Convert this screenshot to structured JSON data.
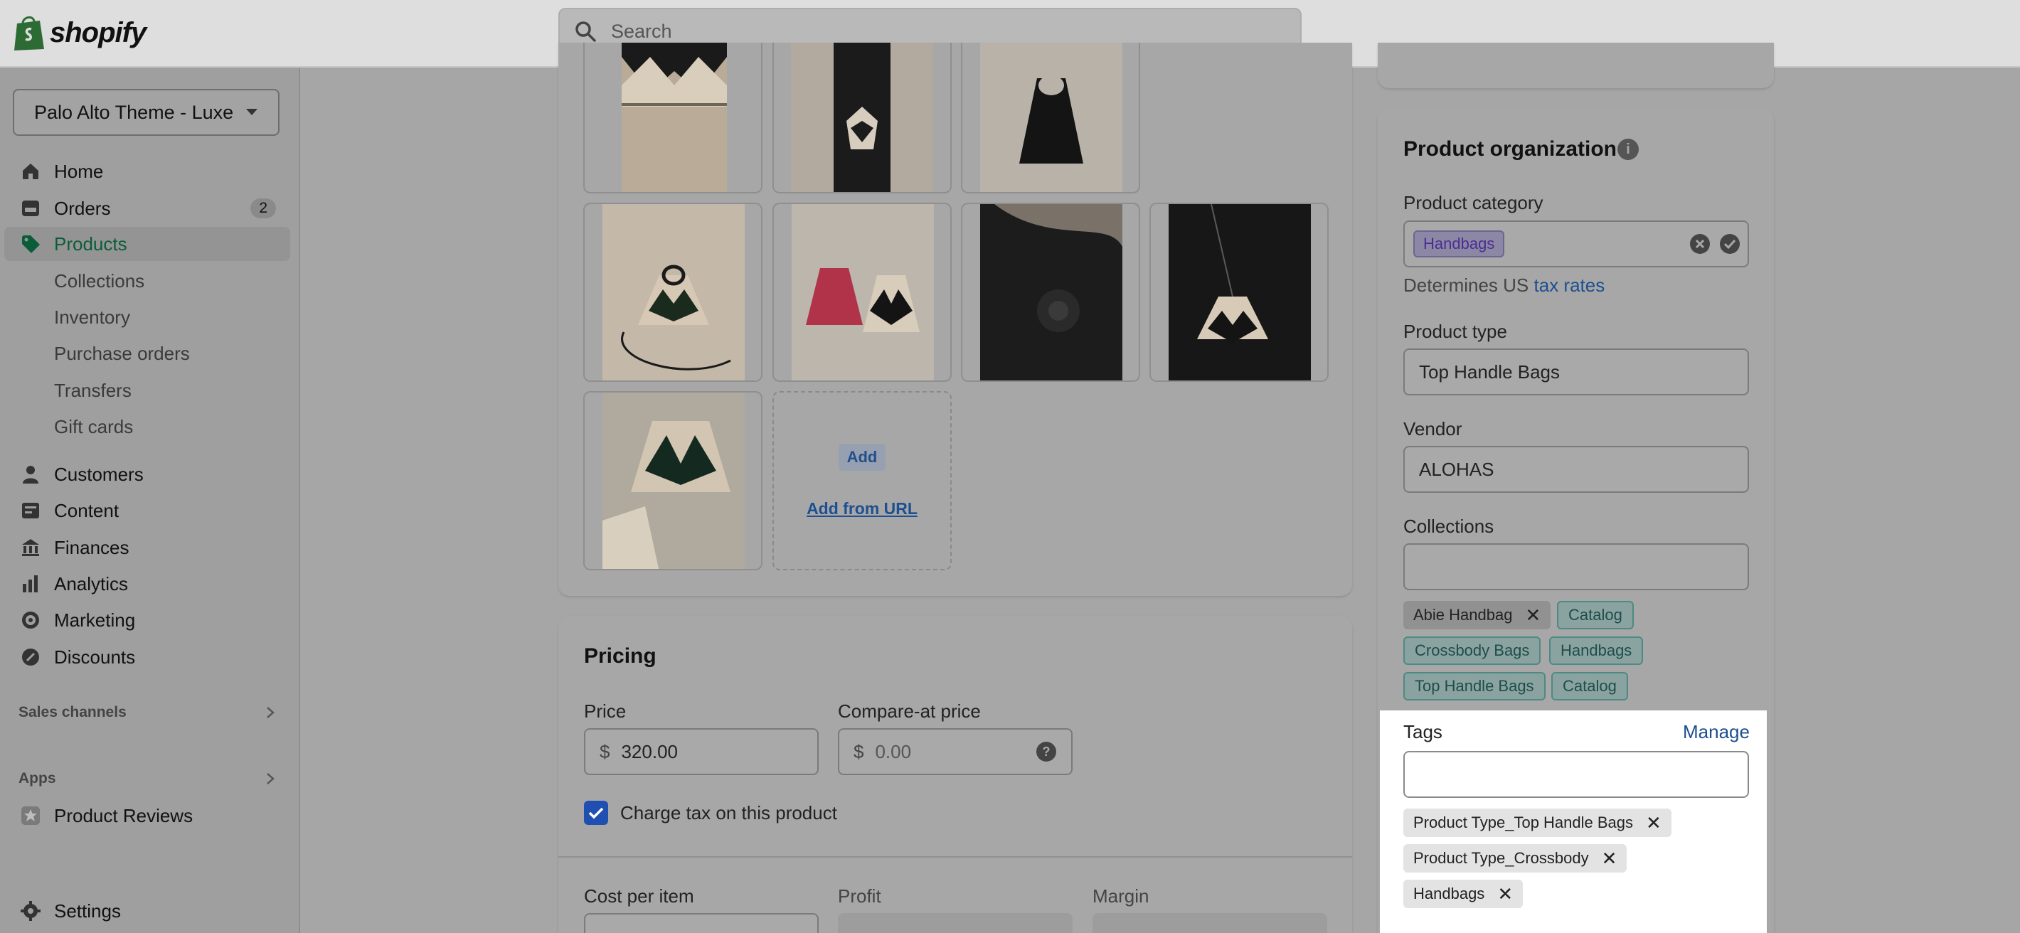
{
  "brand": {
    "name": "shopify"
  },
  "search": {
    "placeholder": "Search"
  },
  "store": {
    "name": "Palo Alto Theme - Luxe"
  },
  "nav": {
    "items": [
      {
        "label": "Home",
        "icon": "home-icon"
      },
      {
        "label": "Orders",
        "icon": "orders-icon",
        "badge": "2"
      },
      {
        "label": "Products",
        "icon": "tag-icon",
        "active": true
      },
      {
        "label": "Collections",
        "sub": true
      },
      {
        "label": "Inventory",
        "sub": true
      },
      {
        "label": "Purchase orders",
        "sub": true
      },
      {
        "label": "Transfers",
        "sub": true
      },
      {
        "label": "Gift cards",
        "sub": true
      },
      {
        "label": "Customers",
        "icon": "person-icon"
      },
      {
        "label": "Content",
        "icon": "content-icon"
      },
      {
        "label": "Finances",
        "icon": "bank-icon"
      },
      {
        "label": "Analytics",
        "icon": "chart-icon"
      },
      {
        "label": "Marketing",
        "icon": "target-icon"
      },
      {
        "label": "Discounts",
        "icon": "discount-icon"
      }
    ],
    "sales_channels": "Sales channels",
    "apps": "Apps",
    "app_item": "Product Reviews",
    "settings": "Settings"
  },
  "media": {
    "add_label": "Add",
    "add_from_url_label": "Add from URL"
  },
  "pricing": {
    "title": "Pricing",
    "price_label": "Price",
    "price_currency": "$",
    "price_value": "320.00",
    "compare_label": "Compare-at price",
    "compare_currency": "$",
    "compare_placeholder": "0.00",
    "charge_tax_label": "Charge tax on this product",
    "charge_tax_checked": true,
    "cost_label": "Cost per item",
    "profit_label": "Profit",
    "margin_label": "Margin"
  },
  "organization": {
    "title": "Product organization",
    "category_label": "Product category",
    "category_value": "Handbags",
    "category_help_prefix": "Determines US",
    "category_help_link": "tax rates",
    "type_label": "Product type",
    "type_value": "Top Handle Bags",
    "vendor_label": "Vendor",
    "vendor_value": "ALOHAS",
    "collections_label": "Collections",
    "collections": [
      {
        "label": "Abie Handbag",
        "style": "grey",
        "removable": true
      },
      {
        "label": "Catalog",
        "style": "teal"
      },
      {
        "label": "Crossbody Bags",
        "style": "teal"
      },
      {
        "label": "Handbags",
        "style": "teal"
      },
      {
        "label": "Top Handle Bags",
        "style": "teal"
      },
      {
        "label": "Catalog",
        "style": "teal"
      }
    ],
    "tags_label": "Tags",
    "manage_label": "Manage",
    "tags": [
      "Product Type_Top Handle Bags",
      "Product Type_Crossbody",
      "Handbags"
    ]
  },
  "colors": {
    "accent": "#1f4fb0",
    "active_nav": "#0b5d3a",
    "link": "#1d4f91",
    "highlight": "#ffffff"
  }
}
